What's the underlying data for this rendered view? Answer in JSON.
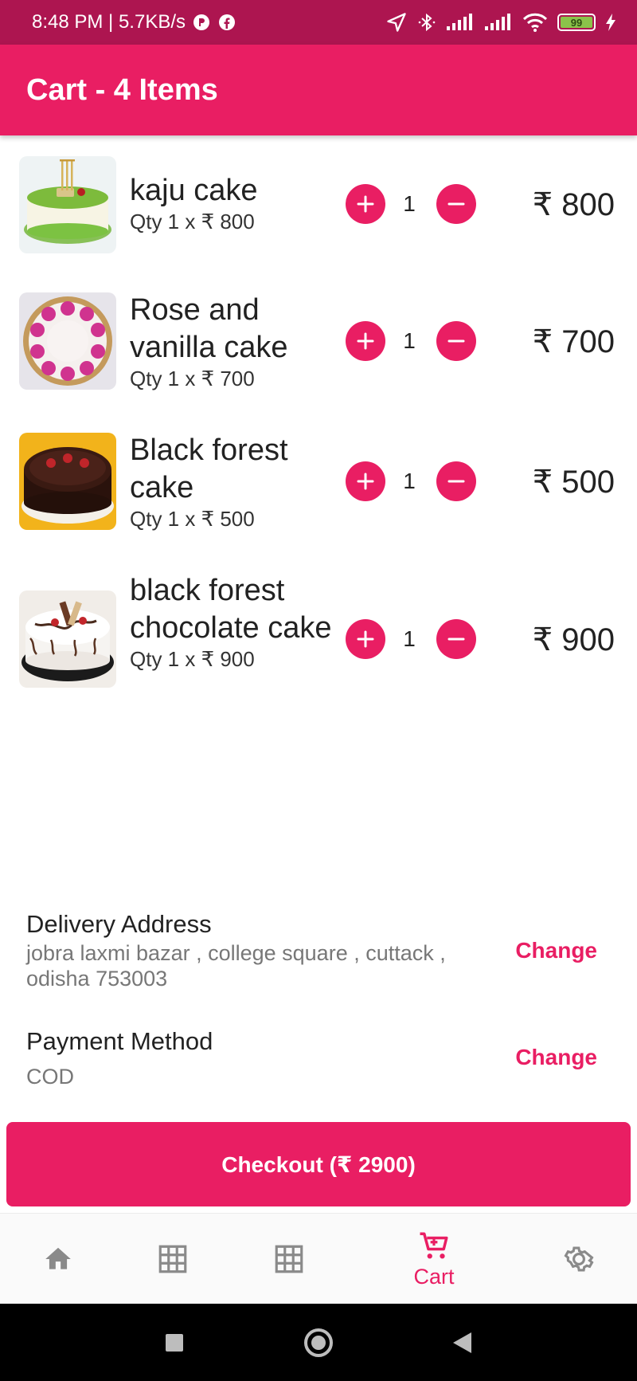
{
  "status_bar": {
    "time_text": "8:48 PM | 5.7KB/s",
    "battery_level": "99"
  },
  "app_bar": {
    "title": "Cart - 4 Items"
  },
  "cart": {
    "items": [
      {
        "name": "kaju cake",
        "qty_line": "Qty 1 x ₹ 800",
        "qty": "1",
        "total": "₹ 800"
      },
      {
        "name": "Rose and vanilla cake",
        "qty_line": "Qty 1 x ₹ 700",
        "qty": "1",
        "total": "₹ 700"
      },
      {
        "name": "Black forest cake",
        "qty_line": "Qty 1 x ₹ 500",
        "qty": "1",
        "total": "₹ 500"
      },
      {
        "name": "black forest chocolate cake",
        "qty_line": "Qty 1 x ₹ 900",
        "qty": "1",
        "total": "₹ 900"
      }
    ]
  },
  "delivery": {
    "label": "Delivery Address",
    "address": "jobra laxmi bazar , college square , cuttack , odisha 753003",
    "change_label": "Change"
  },
  "payment": {
    "label": "Payment Method",
    "method": "COD",
    "change_label": "Change"
  },
  "checkout": {
    "label": "Checkout (₹ 2900)"
  },
  "bottom_nav": {
    "items": [
      {
        "icon": "home-icon",
        "label": ""
      },
      {
        "icon": "grid-icon",
        "label": ""
      },
      {
        "icon": "grid-icon",
        "label": ""
      },
      {
        "icon": "cart-icon",
        "label": "Cart",
        "active": true
      },
      {
        "icon": "gear-icon",
        "label": ""
      }
    ]
  },
  "colors": {
    "primary": "#e91e63",
    "status_bar": "#ad1550",
    "nav_inactive": "#8a8a8a"
  }
}
